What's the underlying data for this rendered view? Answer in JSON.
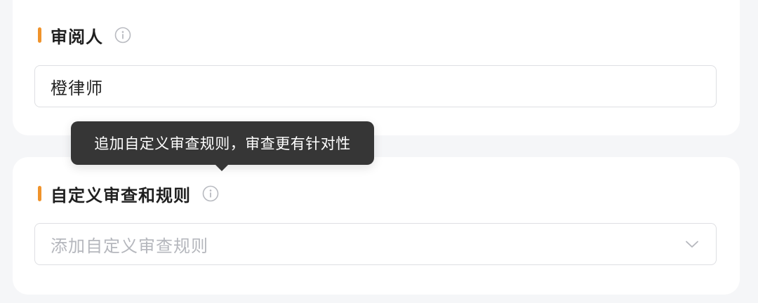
{
  "reviewer": {
    "title": "审阅人",
    "info_icon": "info-circle-icon",
    "value": "橙律师"
  },
  "tooltip": {
    "text": "追加自定义审查规则，审查更有针对性"
  },
  "custom_rules": {
    "title": "自定义审查和规则",
    "info_icon": "info-circle-icon",
    "placeholder": "添加自定义审查规则",
    "dropdown_icon": "chevron-down-icon"
  },
  "colors": {
    "accent": "#f0932b",
    "tooltip_bg": "#363636",
    "placeholder": "#b5b7bd",
    "border": "#dedfe3",
    "page_bg": "#f5f6f8"
  }
}
